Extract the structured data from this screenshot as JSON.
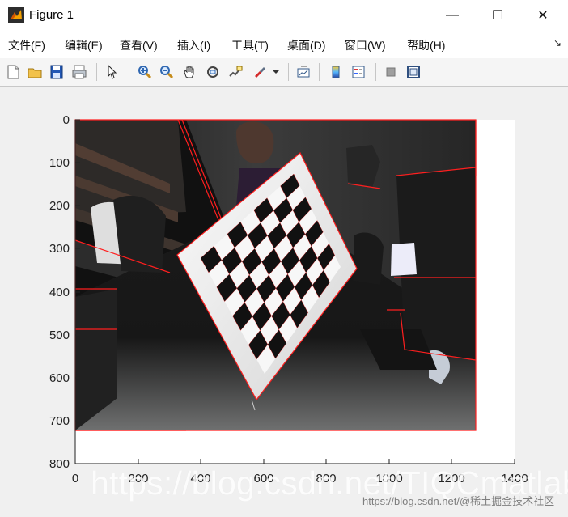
{
  "window": {
    "title": "Figure 1",
    "minimize_label": "—",
    "maximize_label": "☐",
    "close_label": "✕"
  },
  "menubar": {
    "items": [
      {
        "label": "文件(F)"
      },
      {
        "label": "编辑(E)"
      },
      {
        "label": "查看(V)"
      },
      {
        "label": "插入(I)"
      },
      {
        "label": "工具(T)"
      },
      {
        "label": "桌面(D)"
      },
      {
        "label": "窗口(W)"
      },
      {
        "label": "帮助(H)"
      }
    ],
    "extra": "↘"
  },
  "toolbar": {
    "tools": [
      "new-figure-icon",
      "open-file-icon",
      "save-icon",
      "print-icon",
      "select-arrow-icon",
      "zoom-in-icon",
      "zoom-out-icon",
      "pan-hand-icon",
      "rotate-3d-icon",
      "data-cursor-icon",
      "brush-icon",
      "link-plot-icon",
      "insert-colorbar-icon",
      "insert-legend-icon",
      "hide-plot-tools-icon",
      "show-plot-tools-icon"
    ]
  },
  "figure": {
    "x_ticks": [
      "0",
      "200",
      "400",
      "600",
      "800",
      "1000",
      "1200",
      "1400"
    ],
    "y_ticks": [
      "0",
      "100",
      "200",
      "300",
      "400",
      "500",
      "600",
      "700",
      "800"
    ],
    "watermark": "https://blog.csdn.net/TIQCmatlab",
    "watermark_small": "https://blog.csdn.net/@稀土掘金技术社区",
    "colors": {
      "background": "#f0f0f0",
      "axes": "#ffffff",
      "boundary": "#ff1f1f",
      "board_white": "#f2f2f2",
      "board_black": "#111111"
    }
  }
}
